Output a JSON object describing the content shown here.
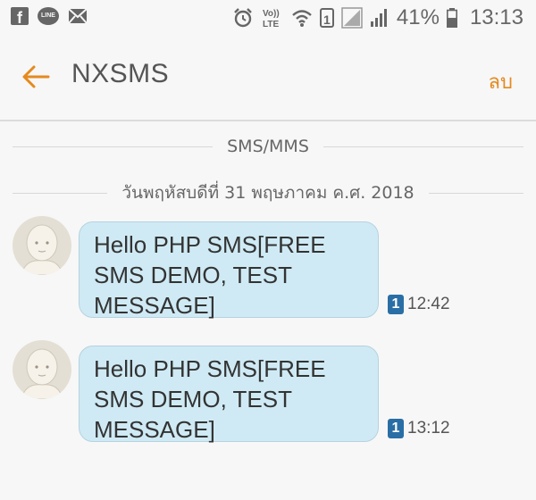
{
  "status_bar": {
    "battery_percent": "41%",
    "time": "13:13",
    "sim_number": "1",
    "icons": [
      "facebook-icon",
      "line-icon",
      "mail-icon",
      "alarm-icon",
      "volte-icon",
      "wifi-icon",
      "sim-icon",
      "signal-icon",
      "signal-icon",
      "battery-icon"
    ],
    "volte_label": "Vo))\nLTE"
  },
  "header": {
    "title": "NXSMS",
    "delete_label": "ลบ",
    "accent_color": "#e58a1f"
  },
  "thread": {
    "type_label": "SMS/MMS",
    "date_label": "วันพฤหัสบดีที่ 31 พฤษภาคม ค.ศ. 2018",
    "messages": [
      {
        "text": "Hello PHP SMS[FREE\nSMS DEMO, TEST\nMESSAGE]",
        "sim": "1",
        "time": "12:42"
      },
      {
        "text": "Hello PHP SMS[FREE\nSMS DEMO, TEST\nMESSAGE]",
        "sim": "1",
        "time": "13:12"
      }
    ],
    "bubble_color": "#cfeaf4",
    "sim_badge_color": "#2a6ea6"
  }
}
